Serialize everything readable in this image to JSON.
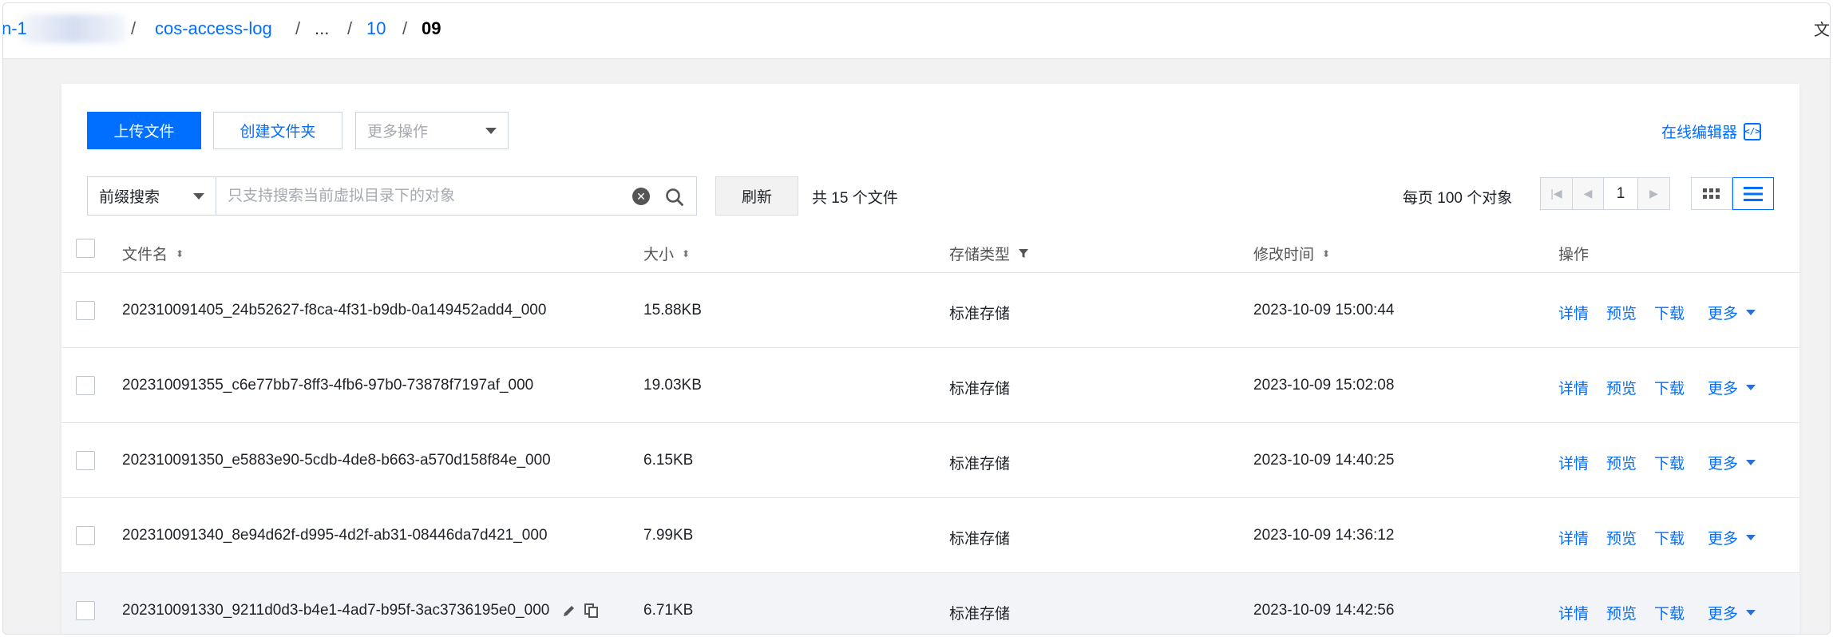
{
  "breadcrumb": {
    "items": [
      {
        "label": "n-1",
        "type": "link"
      },
      {
        "label": "/",
        "type": "sep"
      },
      {
        "label": "cos-access-log",
        "type": "link"
      },
      {
        "label": "/",
        "type": "sep"
      },
      {
        "label": "...",
        "type": "plain"
      },
      {
        "label": "/",
        "type": "sep"
      },
      {
        "label": "10",
        "type": "link"
      },
      {
        "label": "/",
        "type": "sep"
      },
      {
        "label": "09",
        "type": "current"
      }
    ],
    "right_label": "文"
  },
  "toolbar": {
    "upload_label": "上传文件",
    "create_folder_label": "创建文件夹",
    "more_actions_label": "更多操作",
    "online_editor_label": "在线编辑器",
    "online_editor_icon": "code-icon"
  },
  "search": {
    "mode_label": "前缀搜索",
    "placeholder": "只支持搜索当前虚拟目录下的对象",
    "value": "",
    "refresh_label": "刷新",
    "count_text": "共 15 个文件"
  },
  "pagination": {
    "per_page_text": "每页 100 个对象",
    "current_page": "1",
    "view_mode": "list"
  },
  "table": {
    "columns": {
      "name": "文件名",
      "size": "大小",
      "storage": "存储类型",
      "modified": "修改时间",
      "actions": "操作"
    },
    "action_labels": {
      "details": "详情",
      "preview": "预览",
      "download": "下载",
      "more": "更多"
    },
    "rows": [
      {
        "name": "202310091405_24b52627-f8ca-4f31-b9db-0a149452add4_000",
        "size": "15.88KB",
        "storage": "标准存储",
        "modified": "2023-10-09 15:00:44"
      },
      {
        "name": "202310091355_c6e77bb7-8ff3-4fb6-97b0-73878f7197af_000",
        "size": "19.03KB",
        "storage": "标准存储",
        "modified": "2023-10-09 15:02:08"
      },
      {
        "name": "202310091350_e5883e90-5cdb-4de8-b663-a570d158f84e_000",
        "size": "6.15KB",
        "storage": "标准存储",
        "modified": "2023-10-09 14:40:25"
      },
      {
        "name": "202310091340_8e94d62f-d995-4d2f-ab31-08446da7d421_000",
        "size": "7.99KB",
        "storage": "标准存储",
        "modified": "2023-10-09 14:36:12"
      },
      {
        "name": "202310091330_9211d0d3-b4e1-4ad7-b95f-3ac3736195e0_000",
        "size": "6.71KB",
        "storage": "标准存储",
        "modified": "2023-10-09 14:42:56"
      }
    ]
  },
  "colors": {
    "accent": "#006eff",
    "hover_row": "#f3f4f7"
  }
}
